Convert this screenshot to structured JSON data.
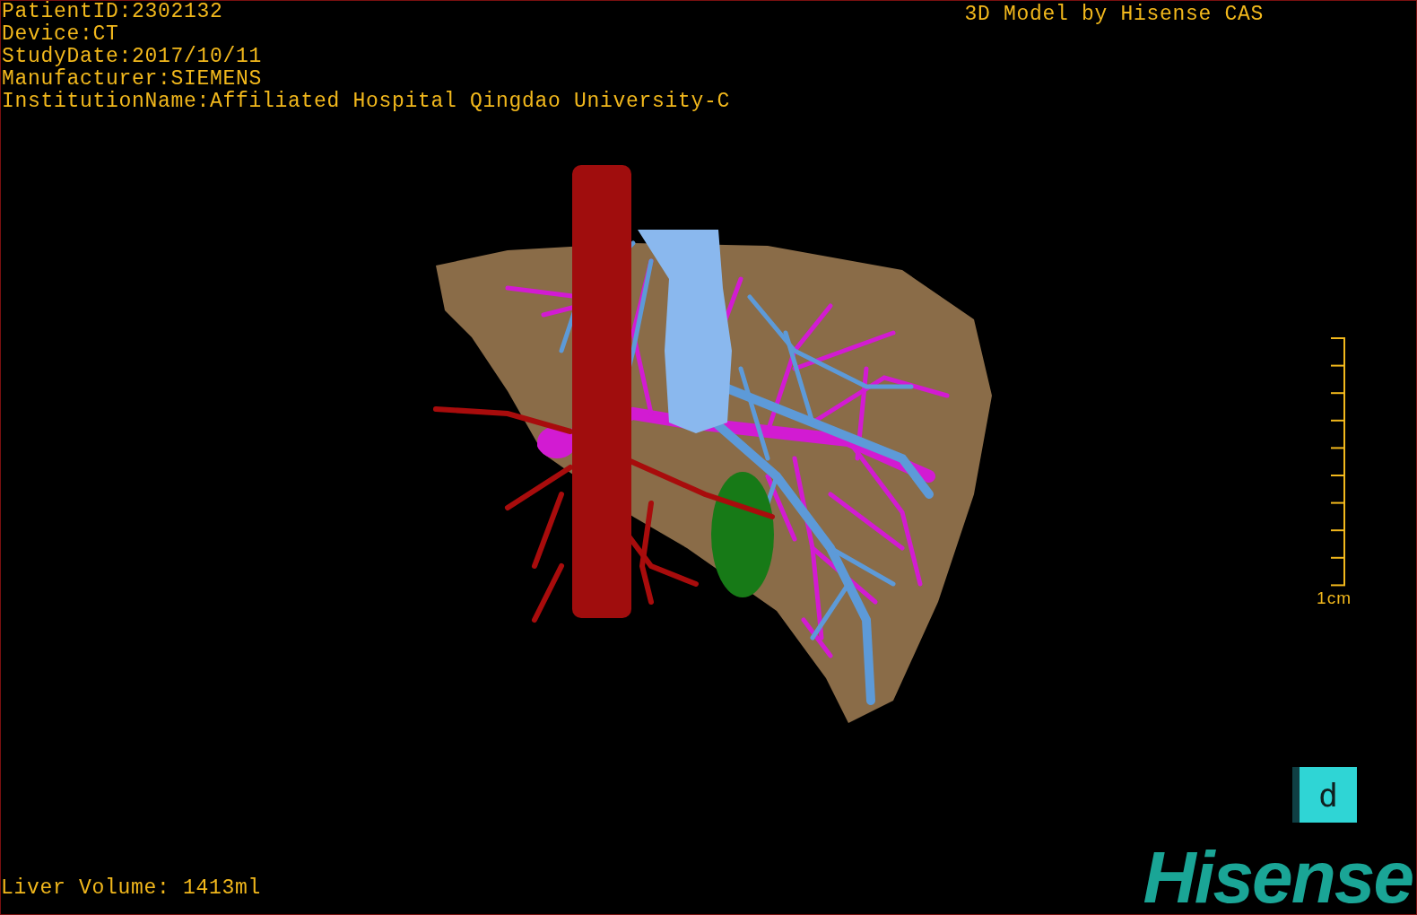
{
  "patient_info": [
    "PatientID:2302132",
    "Device:CT",
    "StudyDate:2017/10/11",
    "Manufacturer:SIEMENS",
    "InstitutionName:Affiliated Hospital Qingdao University-C"
  ],
  "title": "3D Model by Hisense CAS",
  "scale_bar": {
    "label": "1cm"
  },
  "liver_volume": "Liver Volume: 1413ml",
  "orientation_cube": {
    "face_label": "d"
  },
  "logo": "Hisense"
}
